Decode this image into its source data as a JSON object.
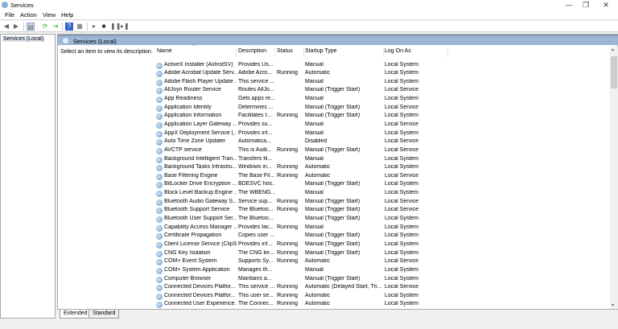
{
  "window": {
    "title": "Services",
    "minimize": "—",
    "maximize": "❐",
    "close": "✕"
  },
  "menu": [
    "File",
    "Action",
    "View",
    "Help"
  ],
  "toolbar": {
    "icons": [
      "back-icon",
      "forward-icon",
      "show-hide-console-tree-icon",
      "refresh-icon",
      "export-list-icon",
      "help-icon",
      "properties-icon",
      "start-service-icon",
      "stop-service-icon",
      "pause-service-icon",
      "restart-service-icon"
    ]
  },
  "tree": {
    "root": "Services (Local)"
  },
  "panel": {
    "title": "Services (Local)",
    "hint": "Select an item to view its description."
  },
  "columns": [
    "Name",
    "Description",
    "Status",
    "Startup Type",
    "Log On As"
  ],
  "rows": [
    [
      "ActiveX Installer (AxInstSV)",
      "Provides Us...",
      "",
      "Manual",
      "Local System"
    ],
    [
      "Adobe Acrobat Update Serv...",
      "Adobe Acro...",
      "Running",
      "Automatic",
      "Local System"
    ],
    [
      "Adobe Flash Player Update ...",
      "This service ...",
      "",
      "Manual",
      "Local System"
    ],
    [
      "AllJoyn Router Service",
      "Routes AllJo...",
      "",
      "Manual (Trigger Start)",
      "Local Service"
    ],
    [
      "App Readiness",
      "Gets apps re...",
      "",
      "Manual",
      "Local System"
    ],
    [
      "Application Identity",
      "Determines ...",
      "",
      "Manual (Trigger Start)",
      "Local Service"
    ],
    [
      "Application Information",
      "Facilitates t...",
      "Running",
      "Manual (Trigger Start)",
      "Local System"
    ],
    [
      "Application Layer Gateway ...",
      "Provides su...",
      "",
      "Manual",
      "Local Service"
    ],
    [
      "AppX Deployment Service (...",
      "Provides inf...",
      "",
      "Manual",
      "Local System"
    ],
    [
      "Auto Time Zone Updater",
      "Automatica...",
      "",
      "Disabled",
      "Local Service"
    ],
    [
      "AVCTP service",
      "This is Audi...",
      "Running",
      "Manual (Trigger Start)",
      "Local Service"
    ],
    [
      "Background Intelligent Tran...",
      "Transfers fil...",
      "",
      "Manual",
      "Local System"
    ],
    [
      "Background Tasks Infrastru...",
      "Windows in...",
      "Running",
      "Automatic",
      "Local System"
    ],
    [
      "Base Filtering Engine",
      "The Base Fil...",
      "Running",
      "Automatic",
      "Local Service"
    ],
    [
      "BitLocker Drive Encryption ...",
      "BDESVC hos...",
      "",
      "Manual (Trigger Start)",
      "Local System"
    ],
    [
      "Block Level Backup Engine ...",
      "The WBENG...",
      "",
      "Manual",
      "Local System"
    ],
    [
      "Bluetooth Audio Gateway S...",
      "Service sup...",
      "Running",
      "Manual (Trigger Start)",
      "Local Service"
    ],
    [
      "Bluetooth Support Service",
      "The Bluetoo...",
      "Running",
      "Manual (Trigger Start)",
      "Local Service"
    ],
    [
      "Bluetooth User Support Ser...",
      "The Bluetoo...",
      "",
      "Manual (Trigger Start)",
      "Local System"
    ],
    [
      "Capability Access Manager ...",
      "Provides fac...",
      "Running",
      "Manual",
      "Local System"
    ],
    [
      "Certificate Propagation",
      "Copies user ...",
      "",
      "Manual (Trigger Start)",
      "Local System"
    ],
    [
      "Client License Service (ClipS...",
      "Provides inf...",
      "Running",
      "Manual (Trigger Start)",
      "Local System"
    ],
    [
      "CNG Key Isolation",
      "The CNG ke...",
      "Running",
      "Manual (Trigger Start)",
      "Local System"
    ],
    [
      "COM+ Event System",
      "Supports Sy...",
      "Running",
      "Automatic",
      "Local Service"
    ],
    [
      "COM+ System Application",
      "Manages th...",
      "",
      "Manual",
      "Local System"
    ],
    [
      "Computer Browser",
      "Maintains a...",
      "",
      "Manual (Trigger Start)",
      "Local System"
    ],
    [
      "Connected Devices Platfor...",
      "This service ...",
      "Running",
      "Automatic (Delayed Start, Tri...",
      "Local Service"
    ],
    [
      "Connected Devices Platfor...",
      "This user se...",
      "Running",
      "Automatic",
      "Local System"
    ],
    [
      "Connected User Experience...",
      "The Connec...",
      "Running",
      "Automatic",
      "Local System"
    ]
  ],
  "tabs": [
    "Extended",
    "Standard"
  ],
  "colors": {
    "header_band": "#9cb6d8"
  }
}
